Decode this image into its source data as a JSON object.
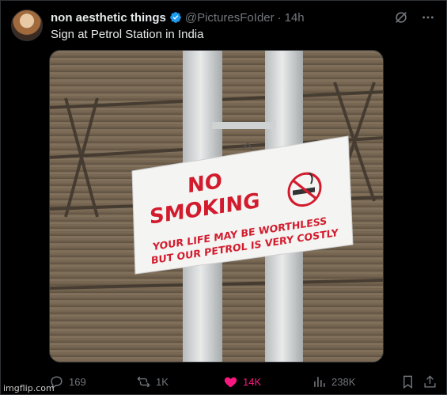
{
  "post": {
    "author_name": "non aesthetic things",
    "handle": "@PicturesFoIder",
    "separator": "·",
    "time": "14h",
    "text": "Sign at Petrol Station in India"
  },
  "sign": {
    "line1": "NO",
    "line2": "SMOKING",
    "line3": "YOUR LIFE MAY BE WORTHLESS",
    "line4": "BUT OUR PETROL IS VERY COSTLY"
  },
  "actions": {
    "replies": "169",
    "reposts": "1K",
    "likes": "14K",
    "views": "238K"
  },
  "watermark": "imgflip.com",
  "colors": {
    "background": "#000000",
    "text_primary": "#e7e9ea",
    "text_secondary": "#71767b",
    "verified": "#1d9bf0",
    "like": "#f91880",
    "sign_red": "#d21c2e"
  },
  "icons": [
    "verified-icon",
    "grok-icon",
    "more-icon",
    "reply-icon",
    "repost-icon",
    "like-icon",
    "views-icon",
    "bookmark-icon",
    "share-icon",
    "no-smoking-icon"
  ]
}
